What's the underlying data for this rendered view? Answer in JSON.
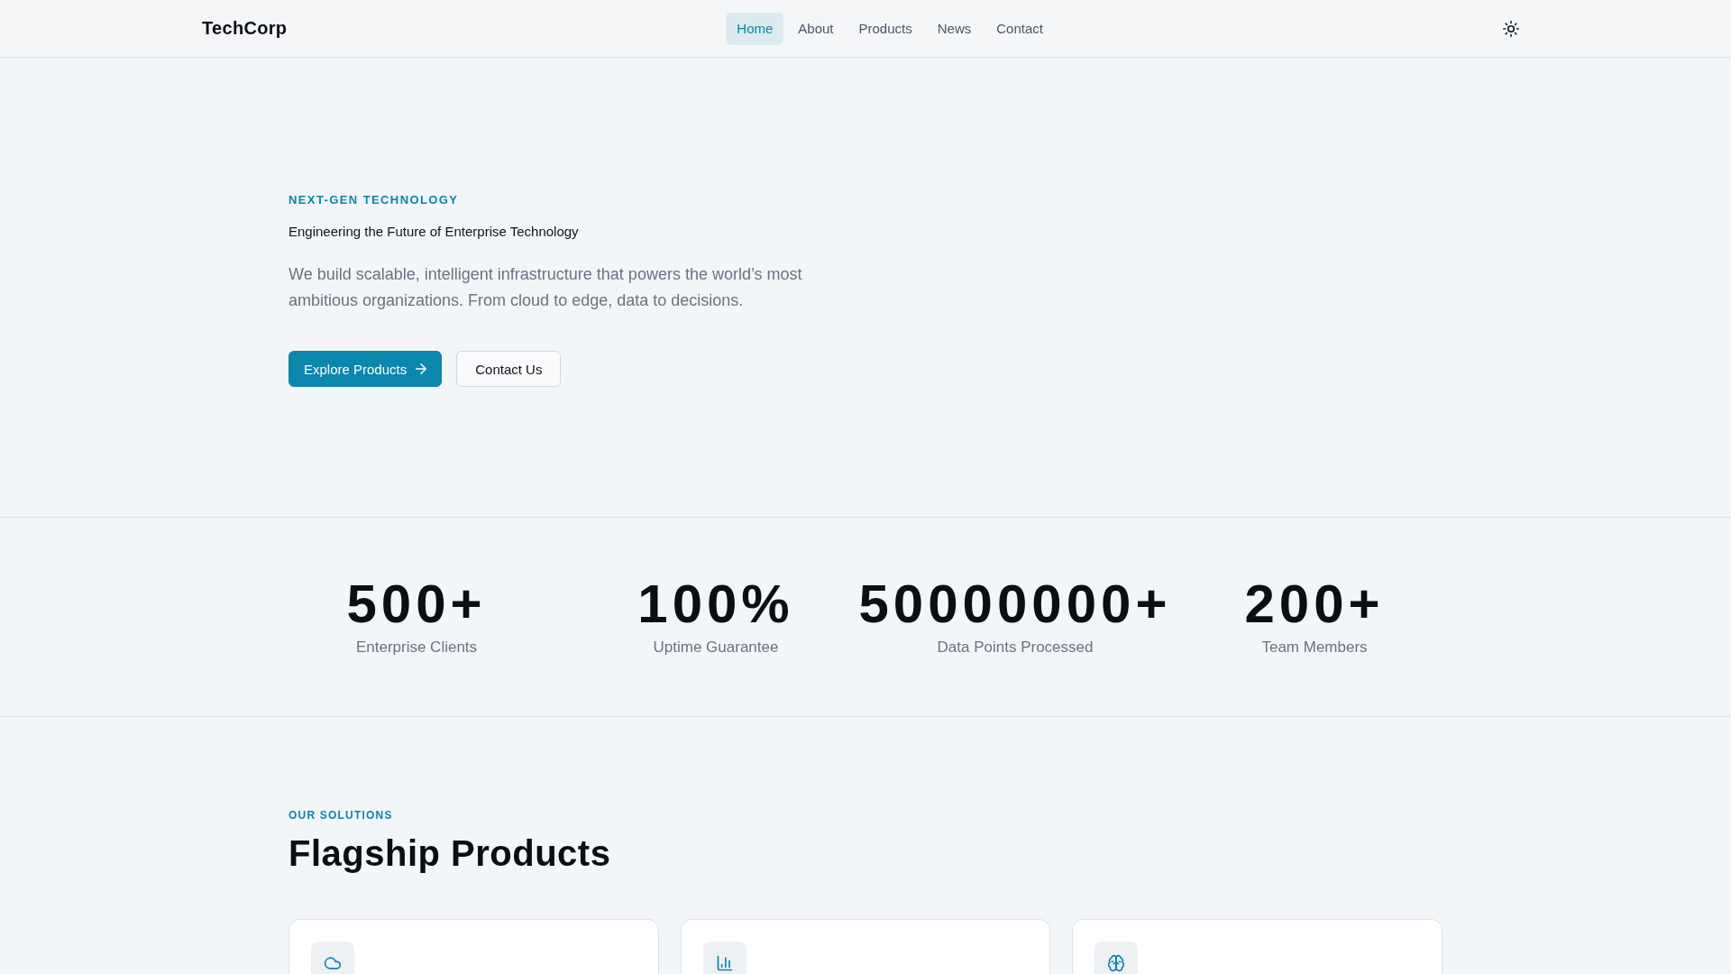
{
  "header": {
    "logo": "TechCorp",
    "nav": [
      {
        "label": "Home",
        "selected": true
      },
      {
        "label": "About",
        "selected": false
      },
      {
        "label": "Products",
        "selected": false
      },
      {
        "label": "News",
        "selected": false
      },
      {
        "label": "Contact",
        "selected": false
      }
    ]
  },
  "hero": {
    "eyebrow": "NEXT-GEN TECHNOLOGY",
    "title": "Engineering the Future of Enterprise Technology",
    "description": "We build scalable, intelligent infrastructure that powers the world’s most ambitious organizations. From cloud to edge, data to decisions.",
    "buttons": [
      {
        "label": "Explore Products",
        "kind": "primary"
      },
      {
        "label": "Contact Us",
        "kind": "secondary"
      }
    ]
  },
  "stats": [
    {
      "value": "500+",
      "label": "Enterprise Clients"
    },
    {
      "value": "100%",
      "label": "Uptime Guarantee"
    },
    {
      "value": "50000000+",
      "label": "Data Points Processed"
    },
    {
      "value": "200+",
      "label": "Team Members"
    }
  ],
  "solutions": {
    "eyebrow": "OUR SOLUTIONS",
    "title": "Flagship Products",
    "cards": [
      {
        "kind": "cloud"
      },
      {
        "kind": "chart"
      },
      {
        "kind": "brain"
      }
    ]
  }
}
